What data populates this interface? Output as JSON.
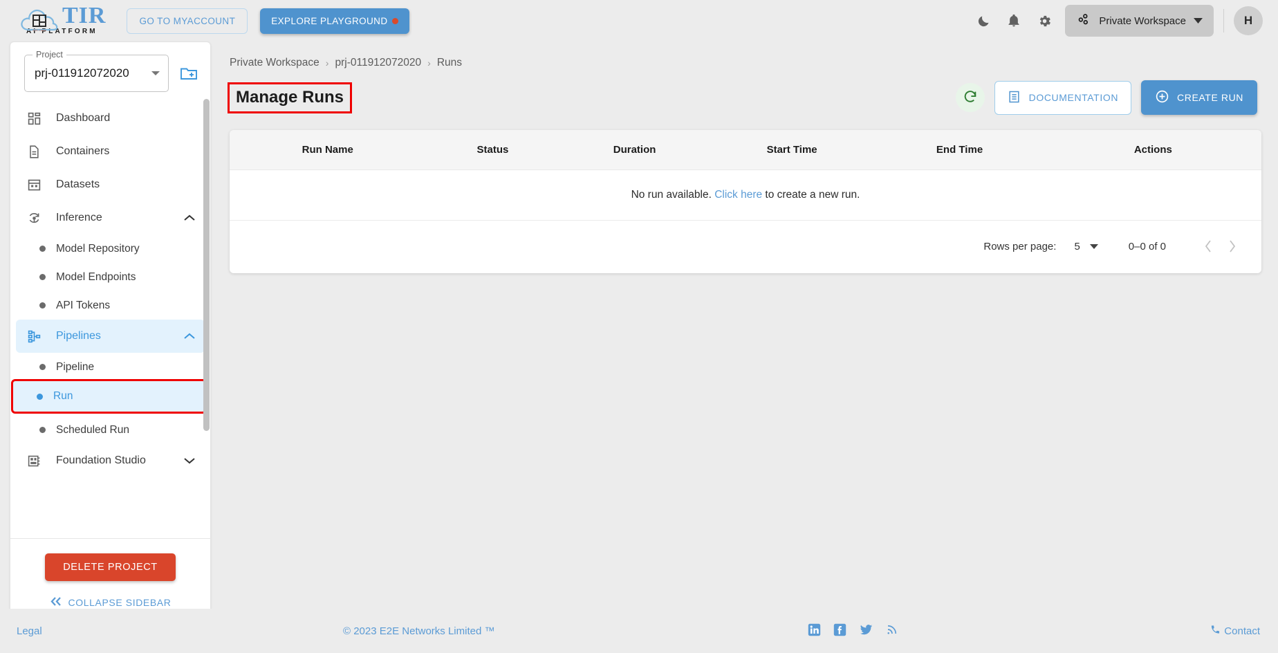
{
  "topbar": {
    "logo_text": "TIR",
    "logo_sub": "AI PLATFORM",
    "myaccount_label": "GO TO MYACCOUNT",
    "playground_label": "EXPLORE PLAYGROUND",
    "dark_mode_icon": "moon-icon",
    "notifications_icon": "bell-icon",
    "settings_icon": "gear-icon",
    "workspace_label": "Private Workspace",
    "avatar_initial": "H"
  },
  "sidebar": {
    "project_legend": "Project",
    "project_value": "prj-011912072020",
    "new_project_icon": "new-folder-icon",
    "items": [
      {
        "label": "Dashboard",
        "icon": "dashboard-icon",
        "type": "item"
      },
      {
        "label": "Containers",
        "icon": "document-icon",
        "type": "item"
      },
      {
        "label": "Datasets",
        "icon": "grid-icon",
        "type": "item"
      },
      {
        "label": "Inference",
        "icon": "inference-icon",
        "type": "group",
        "expanded": true
      },
      {
        "label": "Model Repository",
        "icon": "bullet",
        "type": "sub"
      },
      {
        "label": "Model Endpoints",
        "icon": "bullet",
        "type": "sub"
      },
      {
        "label": "API Tokens",
        "icon": "bullet",
        "type": "sub"
      },
      {
        "label": "Pipelines",
        "icon": "pipelines-icon",
        "type": "group",
        "expanded": true,
        "active": true
      },
      {
        "label": "Pipeline",
        "icon": "bullet",
        "type": "sub"
      },
      {
        "label": "Run",
        "icon": "bullet",
        "type": "sub",
        "selected": true,
        "annotated": true
      },
      {
        "label": "Scheduled Run",
        "icon": "bullet",
        "type": "sub"
      },
      {
        "label": "Foundation Studio",
        "icon": "studio-icon",
        "type": "group",
        "expanded": false
      }
    ],
    "delete_project_label": "DELETE PROJECT",
    "collapse_label": "COLLAPSE SIDEBAR"
  },
  "breadcrumb": {
    "items": [
      "Private Workspace",
      "prj-011912072020",
      "Runs"
    ],
    "separator": "›"
  },
  "header": {
    "title": "Manage Runs",
    "refresh_icon": "refresh-icon",
    "documentation_label": "DOCUMENTATION",
    "create_run_label": "CREATE RUN"
  },
  "table": {
    "columns": [
      "Run Name",
      "Status",
      "Duration",
      "Start Time",
      "End Time",
      "Actions"
    ],
    "rows": [],
    "empty_prefix": "No run available. ",
    "empty_link": "Click here",
    "empty_suffix": " to create a new run."
  },
  "pagination": {
    "rows_per_page_label": "Rows per page:",
    "rows_per_page_value": "5",
    "range_label": "0–0 of 0",
    "prev_icon": "chevron-left-icon",
    "next_icon": "chevron-right-icon"
  },
  "footer": {
    "legal": "Legal",
    "copyright": "© 2023 E2E Networks Limited ™",
    "social": [
      "linkedin-icon",
      "facebook-icon",
      "twitter-icon",
      "rss-icon"
    ],
    "contact": "Contact"
  },
  "colors": {
    "accent_blue": "#4f93ce",
    "link_blue": "#5b9bd5",
    "selected_bg": "#e3f2fd",
    "danger_red": "#d9452b",
    "annotation_red": "#ef0000",
    "refresh_green": "#2e7d32"
  }
}
